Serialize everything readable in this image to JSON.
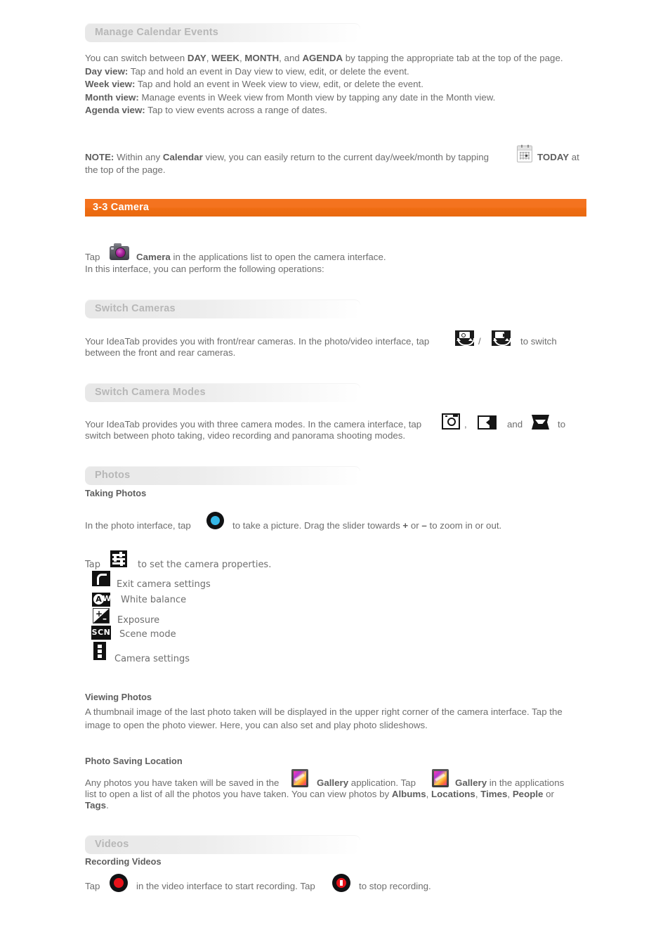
{
  "colors": {
    "accent_orange": "#f4731f",
    "subhead_text": "#b7b7b7",
    "body_text": "#6e6e6e",
    "shutter_blue": "#35b8e8",
    "record_red": "#e8121a"
  },
  "sections": {
    "manage_calendar": {
      "heading": "Manage Calendar Events",
      "intro_pre": "You can switch between ",
      "intro_day": "DAY",
      "intro_sep1": ", ",
      "intro_week": "WEEK",
      "intro_sep2": ", ",
      "intro_month": "MONTH",
      "intro_sep3": ", and ",
      "intro_agenda": "AGENDA",
      "intro_post": " by tapping the appropriate tab at the top of the page.",
      "lines": [
        {
          "label": "Day view:",
          "text": " Tap and hold an event in Day view to view, edit, or delete the event."
        },
        {
          "label": "Week view:",
          "text": " Tap and hold an event in Week view to view, edit, or delete the event."
        },
        {
          "label": "Month view:",
          "text": " Manage events in Week view from Month view by tapping any date in the Month view."
        },
        {
          "label": "Agenda view:",
          "text": " Tap to view events across a range of dates."
        }
      ]
    },
    "note": {
      "label": "NOTE:",
      "part1": " Within any ",
      "bold_calendar": "Calendar",
      "part2": " view, you can easily return to the current day/week/month by tapping",
      "icon": "calendar-today-icon",
      "today_bold": "TODAY",
      "part3": " at",
      "line2": "the top of the page."
    },
    "chapter": {
      "title": "3-3 Camera"
    },
    "camera_intro": {
      "tap": "Tap",
      "icon": "camera-app-icon",
      "bold_camera": "Camera",
      "rest": " in the applications list to open the camera interface.",
      "line2": "In this interface, you can perform the following operations:"
    },
    "switch_cameras": {
      "heading": "Switch Cameras",
      "text1": "Your IdeaTab provides you with front/rear cameras. In the photo/video interface, tap",
      "icon_front": "front-camera-switch-icon",
      "slash": "/",
      "icon_rear": "rear-camera-switch-icon",
      "text2": "to switch",
      "line2": "between the front and rear cameras."
    },
    "switch_modes": {
      "heading": "Switch Camera Modes",
      "text1": "Your IdeaTab provides you with three camera modes. In the camera interface, tap",
      "icon_photo": "photo-mode-icon",
      "comma": ",",
      "icon_video": "video-mode-icon",
      "and": "and",
      "icon_pano": "panorama-mode-icon",
      "text2": "to",
      "line2": "switch between photo taking, video recording and panorama shooting modes."
    },
    "photos": {
      "heading": "Photos",
      "taking_title": "Taking Photos",
      "taking_pre": "In the photo interface, tap",
      "icon_shutter": "shutter-button-icon",
      "taking_mid": "to take a picture. Drag the slider towards ",
      "plus": "+",
      "or": " or ",
      "minus": "–",
      "taking_post": " to zoom in or out.",
      "settings_tap": "Tap",
      "icon_settings": "camera-properties-icon",
      "settings_rest": "to set the camera properties.",
      "settings_items": [
        {
          "icon": "exit-camera-settings-icon",
          "label": "Exit camera settings"
        },
        {
          "icon": "white-balance-icon",
          "label": "White balance"
        },
        {
          "icon": "exposure-icon",
          "label": "Exposure"
        },
        {
          "icon": "scene-mode-icon",
          "label": "Scene mode"
        },
        {
          "icon": "camera-settings-icon",
          "label": "Camera settings"
        }
      ],
      "viewing_title": "Viewing Photos",
      "viewing_line1": "A thumbnail image of the last photo taken will be displayed in the upper right corner of the camera interface. Tap the",
      "viewing_line2": "image to open the photo viewer. Here, you can also set and play photo slideshows.",
      "saving_title": "Photo Saving Location",
      "saving_pre": "Any photos you have taken will be saved in the",
      "icon_gallery1": "gallery-app-icon",
      "saving_mid1": "application. Tap",
      "icon_gallery2": "gallery-app-icon",
      "saving_bold1": "Gallery",
      "saving_bold2": "Gallery",
      "saving_mid2": "in the applications",
      "saving_line2_pre": "list to open a list of all the photos you have taken. You can view photos by ",
      "albums": "Albums",
      "locations": "Locations",
      "times": "Times",
      "people": "People",
      "saving_or": " or",
      "tags": "Tags",
      "saving_period": "."
    },
    "videos": {
      "heading": "Videos",
      "recording_title": "Recording Videos",
      "tap": "Tap",
      "icon_record": "start-recording-icon",
      "mid": "in the video interface to start recording. Tap",
      "icon_stop": "stop-recording-icon",
      "end": "to stop recording."
    }
  }
}
